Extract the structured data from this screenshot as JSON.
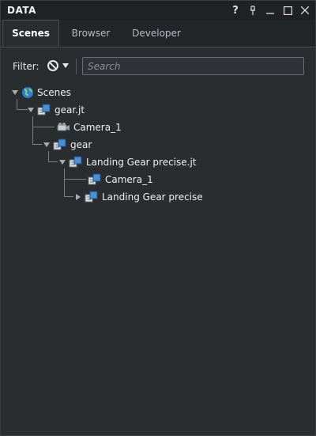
{
  "window": {
    "title": "DATA"
  },
  "titlebar_buttons": [
    "help",
    "pin",
    "minimize",
    "maximize",
    "close"
  ],
  "titlebar_glyphs": {
    "help": "?",
    "pin": "⊥",
    "minimize": "—",
    "maximize": "☐",
    "close": "✕"
  },
  "tabs": [
    {
      "label": "Scenes",
      "active": true
    },
    {
      "label": "Browser",
      "active": false
    },
    {
      "label": "Developer",
      "active": false
    }
  ],
  "filter": {
    "label": "Filter:",
    "icon": "no-filter-icon"
  },
  "search": {
    "placeholder": "Search",
    "value": ""
  },
  "tree": {
    "root": {
      "label": "Scenes",
      "icon": "globe-icon",
      "expanded": true
    },
    "nodes": [
      {
        "label": "gear.jt",
        "icon": "model-icon",
        "expanded": true
      },
      {
        "label": "Camera_1",
        "icon": "camera-icon"
      },
      {
        "label": "gear",
        "icon": "model-icon",
        "expanded": true
      },
      {
        "label": "Landing Gear precise.jt",
        "icon": "model-icon",
        "expanded": true
      },
      {
        "label": "Camera_1",
        "icon": "model-icon"
      },
      {
        "label": "Landing Gear precise",
        "icon": "model-icon",
        "expanded": false
      }
    ]
  },
  "colors": {
    "accent": "#3b8fd6",
    "background": "#2a2d30",
    "titlebar": "#1f2124"
  }
}
